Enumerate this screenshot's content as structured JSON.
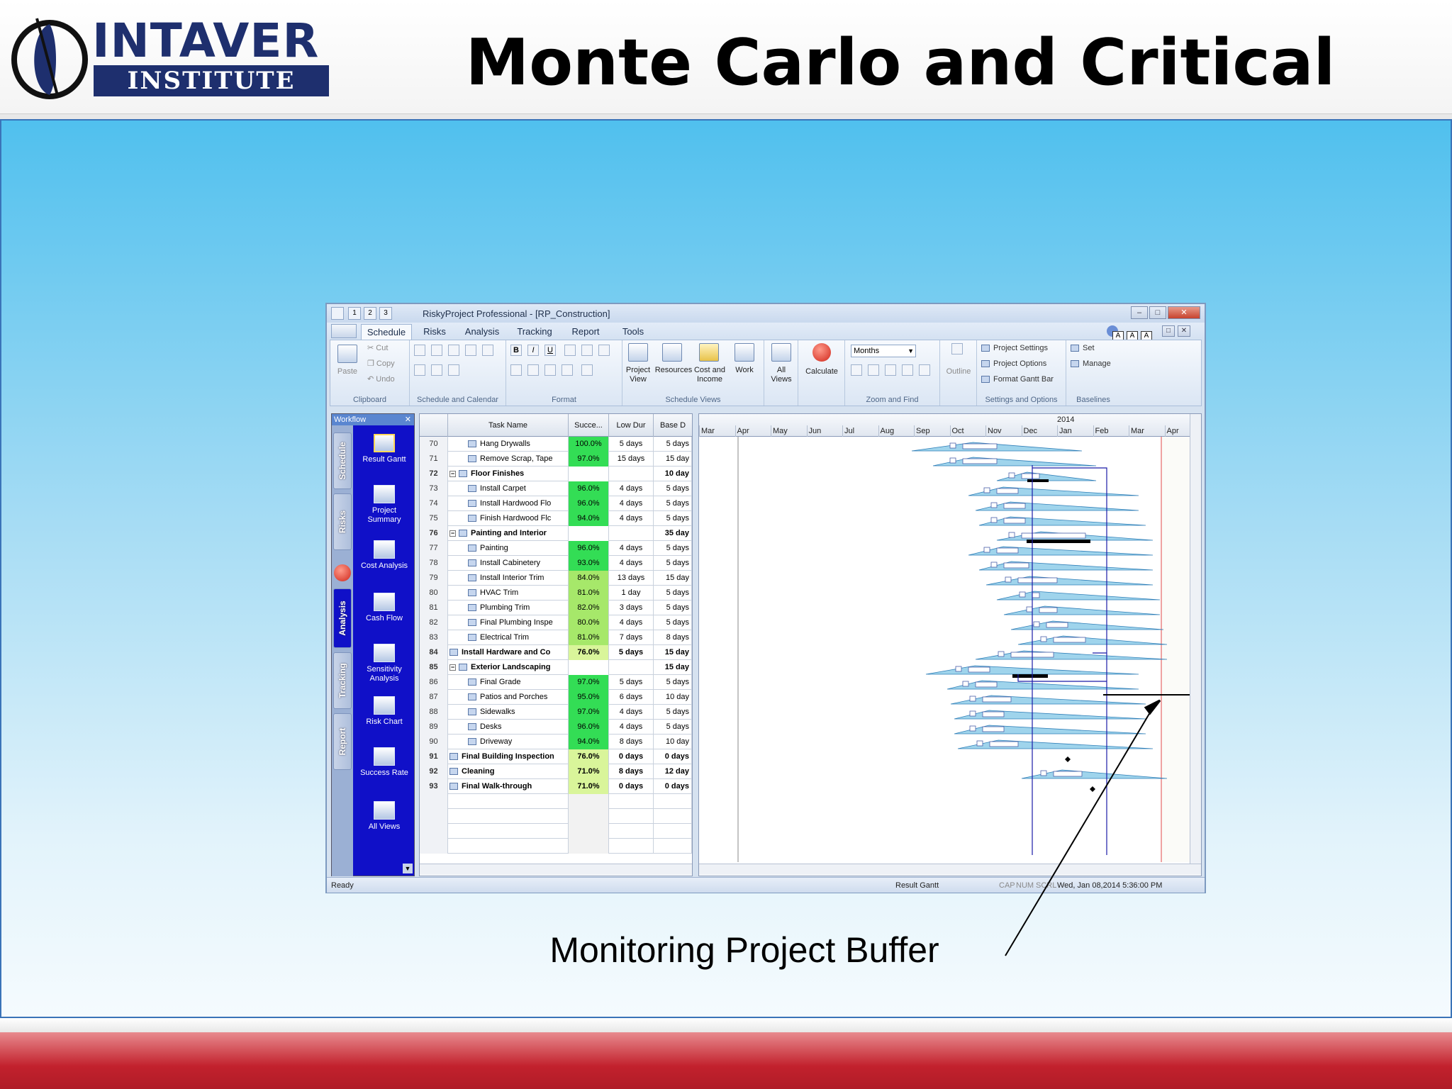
{
  "slide": {
    "title": "Monte Carlo and Critical Chain",
    "logo_top": "INTAVER",
    "logo_bottom": "INSTITUTE",
    "caption": "Monitoring Project Buffer"
  },
  "app": {
    "window_title": "RiskyProject Professional - [RP_Construction]",
    "qat_labels": [
      "1",
      "2",
      "3"
    ],
    "tabs": [
      "Schedule",
      "Risks",
      "Analysis",
      "Tracking",
      "Report",
      "Tools"
    ],
    "active_tab": "Schedule",
    "ribbon": {
      "clipboard": {
        "paste": "Paste",
        "cut": "Cut",
        "copy": "Copy",
        "undo": "Undo",
        "label": "Clipboard"
      },
      "schedule_calendar": {
        "label": "Schedule and Calendar"
      },
      "format": {
        "label": "Format",
        "bold": "B",
        "italic": "I",
        "underline": "U"
      },
      "schedule_views": {
        "label": "Schedule Views",
        "project_view": "Project View",
        "resources": "Resources",
        "cost_income": "Cost and Income",
        "work": "Work"
      },
      "all_views": "All Views",
      "calculate": "Calculate",
      "zoom": {
        "label": "Zoom and Find",
        "scale": "Months"
      },
      "outline": "Outline",
      "settings": {
        "label": "Settings and Options",
        "project_settings": "Project Settings",
        "project_options": "Project Options",
        "format_gantt": "Format Gantt Bar"
      },
      "baselines": {
        "label": "Baselines",
        "set": "Set",
        "manage": "Manage"
      },
      "badges": [
        "A",
        "A",
        "A"
      ]
    },
    "workflow": {
      "header": "Workflow",
      "vtabs": [
        "Schedule",
        "Risks",
        "Analysis",
        "Tracking",
        "Report"
      ],
      "items": [
        "Result Gantt",
        "Project Summary",
        "Cost Analysis",
        "Cash Flow",
        "Sensitivity Analysis",
        "Risk Chart",
        "Success Rate",
        "All Views"
      ]
    },
    "grid": {
      "columns": [
        "Task Name",
        "Succe...",
        "Low Dur",
        "Base D"
      ],
      "rows": [
        {
          "id": "70",
          "name": "Hang Drywalls",
          "succ": "100.0%",
          "low": "5 days",
          "base": "5 days",
          "level": 2,
          "summary": false
        },
        {
          "id": "71",
          "name": "Remove Scrap, Tape",
          "succ": "97.0%",
          "low": "15 days",
          "base": "15 day",
          "level": 2,
          "summary": false
        },
        {
          "id": "72",
          "name": "Floor Finishes",
          "succ": "",
          "low": "",
          "base": "10 day",
          "level": 1,
          "summary": true
        },
        {
          "id": "73",
          "name": "Install Carpet",
          "succ": "96.0%",
          "low": "4 days",
          "base": "5 days",
          "level": 2,
          "summary": false
        },
        {
          "id": "74",
          "name": "Install Hardwood Flo",
          "succ": "96.0%",
          "low": "4 days",
          "base": "5 days",
          "level": 2,
          "summary": false
        },
        {
          "id": "75",
          "name": "Finish Hardwood Flc",
          "succ": "94.0%",
          "low": "4 days",
          "base": "5 days",
          "level": 2,
          "summary": false
        },
        {
          "id": "76",
          "name": "Painting and Interior",
          "succ": "",
          "low": "",
          "base": "35 day",
          "level": 1,
          "summary": true
        },
        {
          "id": "77",
          "name": "Painting",
          "succ": "96.0%",
          "low": "4 days",
          "base": "5 days",
          "level": 2,
          "summary": false
        },
        {
          "id": "78",
          "name": "Install Cabinetery",
          "succ": "93.0%",
          "low": "4 days",
          "base": "5 days",
          "level": 2,
          "summary": false
        },
        {
          "id": "79",
          "name": "Install Interior Trim",
          "succ": "84.0%",
          "low": "13 days",
          "base": "15 day",
          "level": 2,
          "summary": false
        },
        {
          "id": "80",
          "name": "HVAC Trim",
          "succ": "81.0%",
          "low": "1 day",
          "base": "5 days",
          "level": 2,
          "summary": false
        },
        {
          "id": "81",
          "name": "Plumbing Trim",
          "succ": "82.0%",
          "low": "3 days",
          "base": "5 days",
          "level": 2,
          "summary": false
        },
        {
          "id": "82",
          "name": "Final Plumbing Inspe",
          "succ": "80.0%",
          "low": "4 days",
          "base": "5 days",
          "level": 2,
          "summary": false
        },
        {
          "id": "83",
          "name": "Electrical Trim",
          "succ": "81.0%",
          "low": "7 days",
          "base": "8 days",
          "level": 2,
          "summary": false
        },
        {
          "id": "84",
          "name": "Install Hardware and Co",
          "succ": "76.0%",
          "low": "5 days",
          "base": "15 day",
          "level": 0,
          "summary": true
        },
        {
          "id": "85",
          "name": "Exterior Landscaping",
          "succ": "",
          "low": "",
          "base": "15 day",
          "level": 1,
          "summary": true
        },
        {
          "id": "86",
          "name": "Final Grade",
          "succ": "97.0%",
          "low": "5 days",
          "base": "5 days",
          "level": 2,
          "summary": false
        },
        {
          "id": "87",
          "name": "Patios and Porches",
          "succ": "95.0%",
          "low": "6 days",
          "base": "10 day",
          "level": 2,
          "summary": false
        },
        {
          "id": "88",
          "name": "Sidewalks",
          "succ": "97.0%",
          "low": "4 days",
          "base": "5 days",
          "level": 2,
          "summary": false
        },
        {
          "id": "89",
          "name": "Desks",
          "succ": "96.0%",
          "low": "4 days",
          "base": "5 days",
          "level": 2,
          "summary": false
        },
        {
          "id": "90",
          "name": "Driveway",
          "succ": "94.0%",
          "low": "8 days",
          "base": "10 day",
          "level": 2,
          "summary": false
        },
        {
          "id": "91",
          "name": "Final Building Inspection",
          "succ": "76.0%",
          "low": "0 days",
          "base": "0 days",
          "level": 0,
          "summary": true
        },
        {
          "id": "92",
          "name": "Cleaning",
          "succ": "71.0%",
          "low": "8 days",
          "base": "12 day",
          "level": 0,
          "summary": true
        },
        {
          "id": "93",
          "name": "Final Walk-through",
          "succ": "71.0%",
          "low": "0 days",
          "base": "0 days",
          "level": 0,
          "summary": true
        }
      ]
    },
    "gantt": {
      "year": "2014",
      "months": [
        "Mar",
        "Apr",
        "May",
        "Jun",
        "Jul",
        "Aug",
        "Sep",
        "Oct",
        "Nov",
        "Dec",
        "Jan",
        "Feb",
        "Mar",
        "Apr"
      ]
    },
    "status": {
      "left": "Ready",
      "view": "Result Gantt",
      "caps": "CAP",
      "num": "NUM",
      "scrl": "SCRL",
      "datetime": "Wed, Jan 08,2014   5:36:00 PM"
    },
    "colors": {
      "success_high": "#33dd55",
      "success_mid": "#a6e86a",
      "success_low": "#d9f59a",
      "workflow_bg": "#1010c8"
    }
  }
}
